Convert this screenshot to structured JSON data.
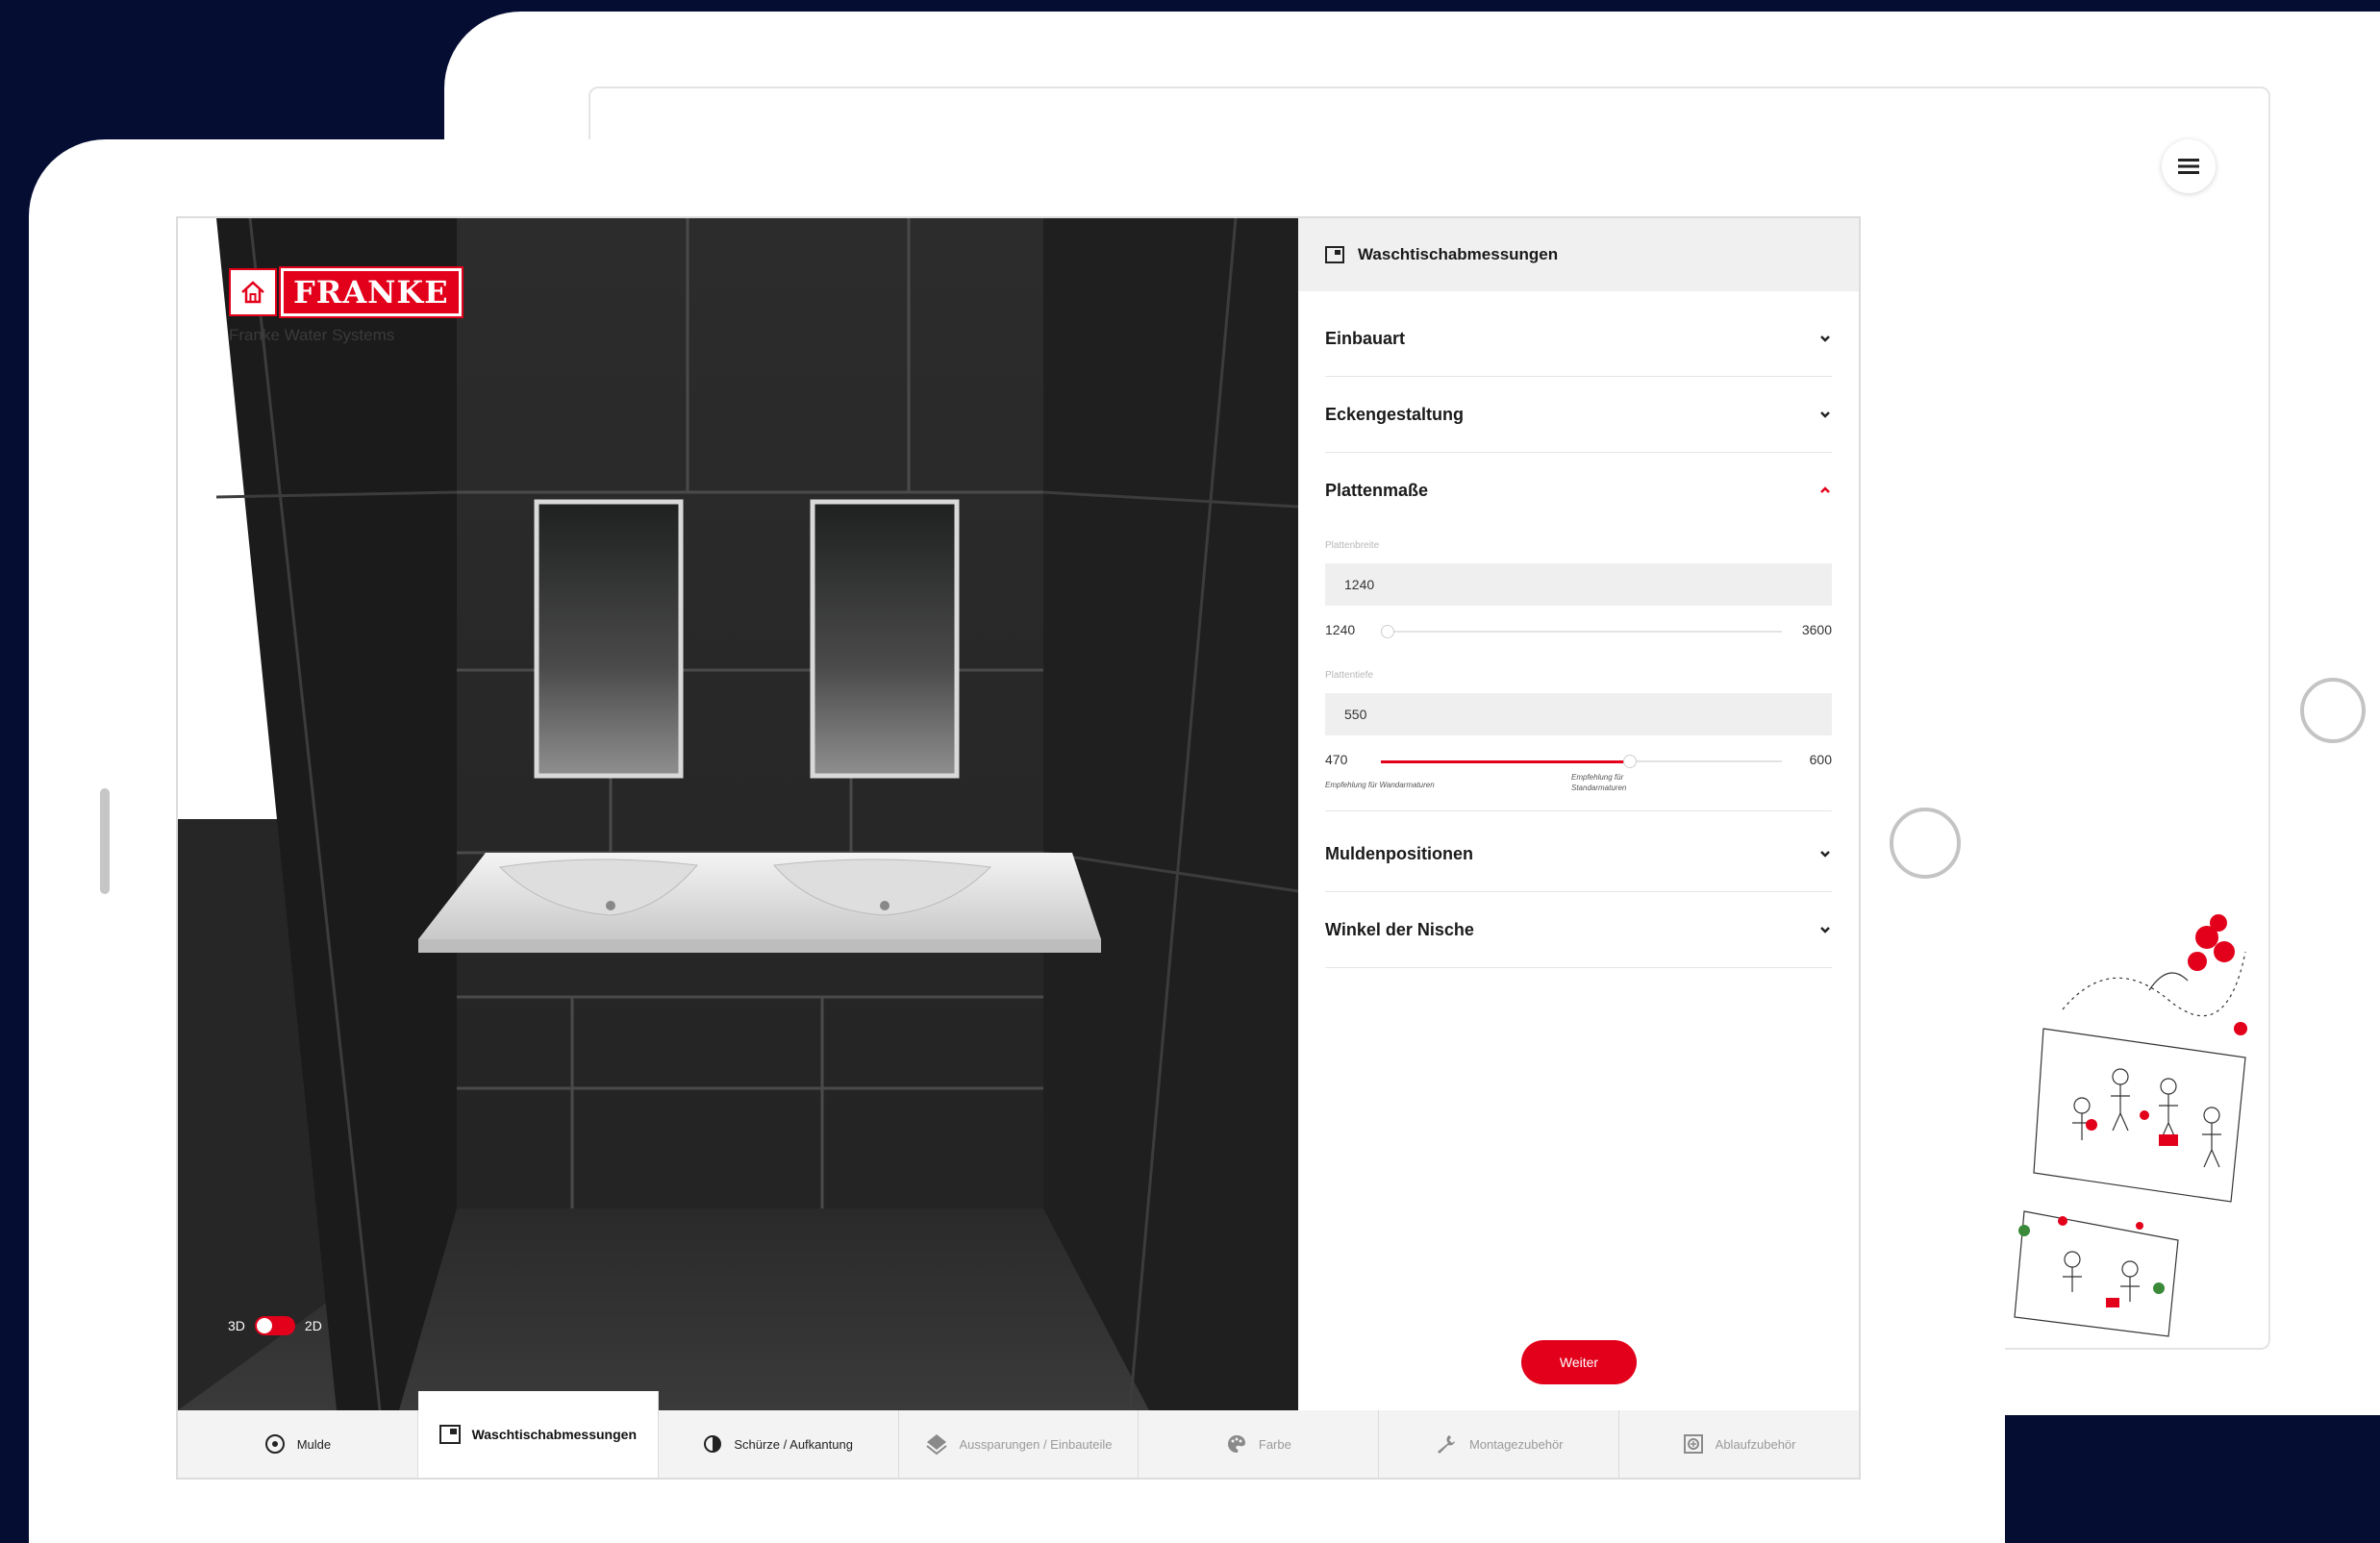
{
  "brand": {
    "name": "FRANKE",
    "subtitle": "Franke Water Systems"
  },
  "view_toggle": {
    "left": "3D",
    "right": "2D"
  },
  "panel": {
    "title": "Waschtischabmessungen",
    "sections": [
      {
        "label": "Einbauart",
        "expanded": false
      },
      {
        "label": "Eckengestaltung",
        "expanded": false
      },
      {
        "label": "Plattenmaße",
        "expanded": true
      },
      {
        "label": "Muldenpositionen",
        "expanded": false
      },
      {
        "label": "Winkel der Nische",
        "expanded": false
      }
    ],
    "plattenbreite": {
      "label": "Plattenbreite",
      "value": "1240",
      "min": "1240",
      "max": "3600",
      "fraction": 0.0
    },
    "plattentiefe": {
      "label": "Plattentiefe",
      "value": "550",
      "min": "470",
      "max": "600",
      "fraction": 0.62,
      "hint_left": "Empfehlung für Wandarmaturen",
      "hint_right_1": "Empfehlung für",
      "hint_right_2": "Standarmaturen"
    },
    "next_label": "Weiter"
  },
  "tabs": [
    {
      "label": "Mulde",
      "icon": "target-icon"
    },
    {
      "label": "Waschtischabmessungen",
      "icon": "dimensions-icon",
      "active": true
    },
    {
      "label": "Schürze / Aufkantung",
      "icon": "half-circle-icon"
    },
    {
      "label": "Aussparungen / Einbauteile",
      "icon": "layers-icon"
    },
    {
      "label": "Farbe",
      "icon": "palette-icon"
    },
    {
      "label": "Montagezubehör",
      "icon": "wrench-icon"
    },
    {
      "label": "Ablaufzubehör",
      "icon": "drain-icon"
    }
  ],
  "colors": {
    "accent": "#e3001b",
    "background": "#050d33"
  }
}
